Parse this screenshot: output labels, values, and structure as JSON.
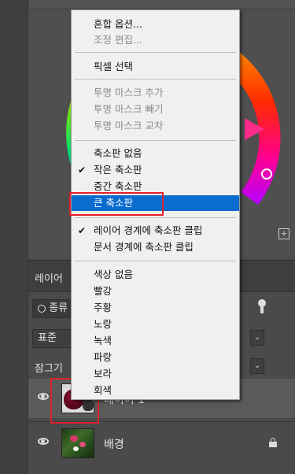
{
  "context_menu": {
    "items": [
      {
        "label": "혼합 옵션...",
        "enabled": true
      },
      {
        "label": "조정 편집...",
        "enabled": false
      },
      {
        "label": "픽셀 선택",
        "enabled": true
      },
      {
        "label": "투명 마스크 추가",
        "enabled": false
      },
      {
        "label": "투명 마스크 빼기",
        "enabled": false
      },
      {
        "label": "투명 마스크 교차",
        "enabled": false
      },
      {
        "label": "축소판 없음",
        "enabled": true
      },
      {
        "label": "작은 축소판",
        "enabled": true,
        "checked": true
      },
      {
        "label": "중간 축소판",
        "enabled": true
      },
      {
        "label": "큰 축소판",
        "enabled": true,
        "highlighted": true
      },
      {
        "label": "레이어 경계에 축소판 클립",
        "enabled": true,
        "checked": true
      },
      {
        "label": "문서 경계에 축소판 클립",
        "enabled": true
      },
      {
        "label": "색상 없음",
        "enabled": true
      },
      {
        "label": "빨강",
        "enabled": true
      },
      {
        "label": "주황",
        "enabled": true
      },
      {
        "label": "노랑",
        "enabled": true
      },
      {
        "label": "녹색",
        "enabled": true
      },
      {
        "label": "파랑",
        "enabled": true
      },
      {
        "label": "보라",
        "enabled": true
      },
      {
        "label": "회색",
        "enabled": true
      }
    ],
    "check_glyph": "✔"
  },
  "layers_panel": {
    "tab_label": "레이어",
    "search_label": "종류",
    "blend_mode": "표준",
    "lock_label": "잠그기",
    "layers": [
      {
        "name": "레이어 1",
        "active": true
      },
      {
        "name": "배경",
        "locked": true
      }
    ]
  },
  "icons": {
    "search": "search-icon",
    "eye": "eye-icon",
    "lock": "lock-icon",
    "add": "add-icon",
    "chevron": "chevron-down-icon"
  },
  "colors": {
    "menu_highlight": "#0a6ccf",
    "annotation_red": "#e0202c",
    "panel_bg": "#4a4a4a"
  }
}
